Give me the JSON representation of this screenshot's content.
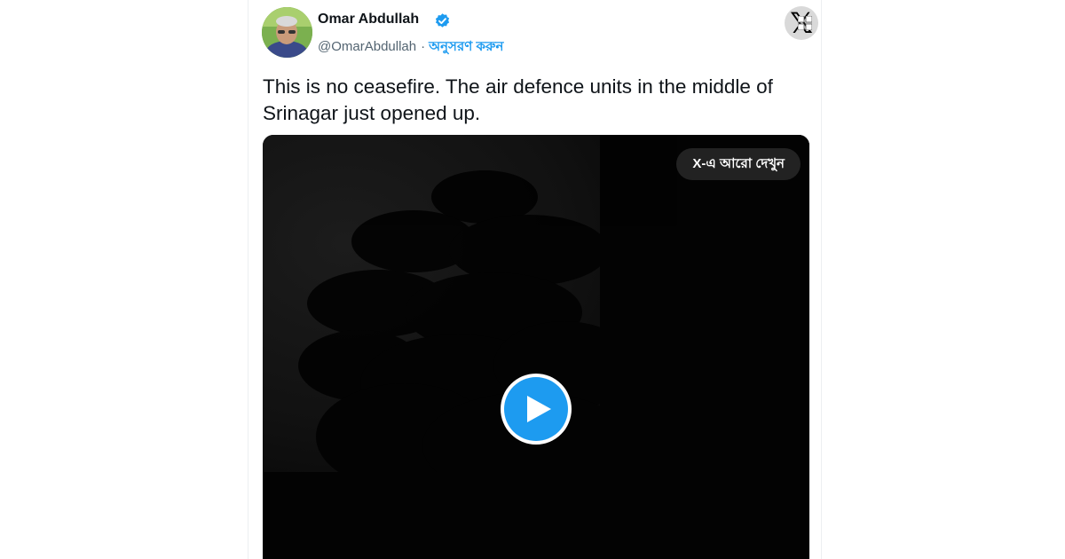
{
  "user": {
    "name": "Omar Abdullah",
    "handle": "@OmarAbdullah",
    "separator": "·",
    "follow_label": "অনুসরণ করুন",
    "verified": true
  },
  "tweet": {
    "text": "This is no ceasefire. The air defence units in the middle of Srinagar just opened up."
  },
  "media": {
    "type": "video",
    "see_more_label": "X-এ আরো দেখুন"
  },
  "icons": {
    "verified": "verified-badge-icon",
    "play": "play-icon",
    "x_logo": "x-logo-icon",
    "corner_overlay": "windows-grid-icon"
  },
  "colors": {
    "accent": "#1d9bf0",
    "text_primary": "#0f1419",
    "text_secondary": "#536471",
    "video_background": "#050505"
  }
}
